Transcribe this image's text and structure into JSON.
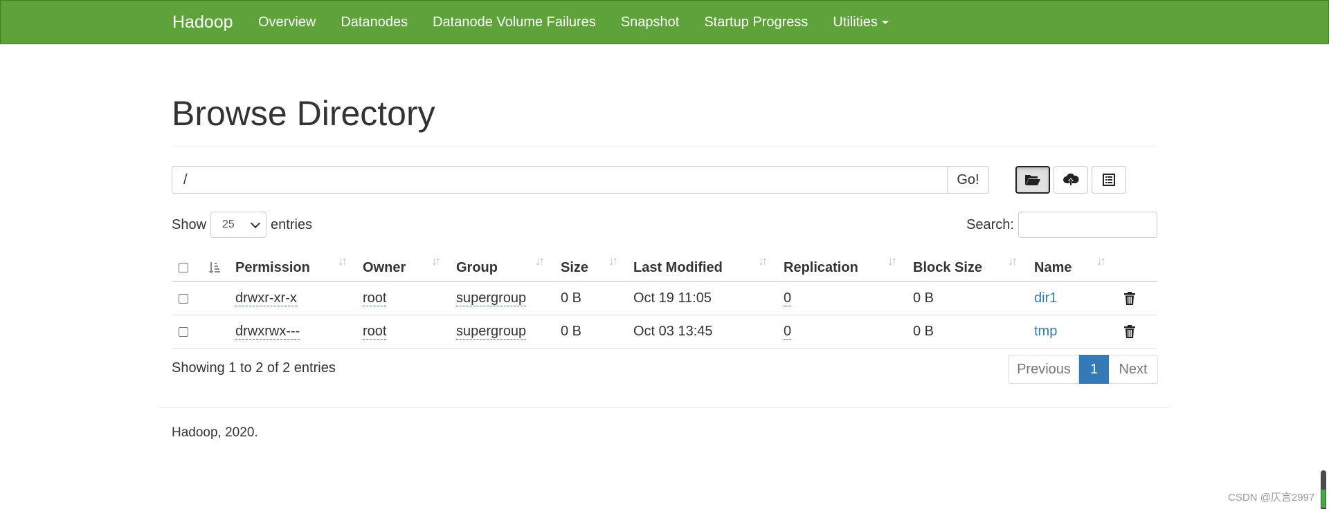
{
  "navbar": {
    "brand": "Hadoop",
    "items": [
      {
        "label": "Overview"
      },
      {
        "label": "Datanodes"
      },
      {
        "label": "Datanode Volume Failures"
      },
      {
        "label": "Snapshot"
      },
      {
        "label": "Startup Progress"
      },
      {
        "label": "Utilities"
      }
    ]
  },
  "page": {
    "title": "Browse Directory"
  },
  "path_bar": {
    "value": "/",
    "go_label": "Go!"
  },
  "toolbar": {
    "icons": [
      "folder-open-icon",
      "cloud-upload-icon",
      "list-icon"
    ]
  },
  "entries": {
    "show_label": "Show",
    "page_size": "25",
    "entries_label": "entries"
  },
  "search": {
    "label": "Search:",
    "value": ""
  },
  "table": {
    "columns": [
      "Permission",
      "Owner",
      "Group",
      "Size",
      "Last Modified",
      "Replication",
      "Block Size",
      "Name"
    ],
    "rows": [
      {
        "permission": "drwxr-xr-x",
        "owner": "root",
        "group": "supergroup",
        "size": "0 B",
        "last_modified": "Oct 19 11:05",
        "replication": "0",
        "block_size": "0 B",
        "name": "dir1"
      },
      {
        "permission": "drwxrwx---",
        "owner": "root",
        "group": "supergroup",
        "size": "0 B",
        "last_modified": "Oct 03 13:45",
        "replication": "0",
        "block_size": "0 B",
        "name": "tmp"
      }
    ]
  },
  "pagination": {
    "info": "Showing 1 to 2 of 2 entries",
    "previous": "Previous",
    "current": "1",
    "next": "Next"
  },
  "footer": {
    "text": "Hadoop, 2020."
  },
  "watermark": {
    "text": "CSDN @仄言2997"
  },
  "colors": {
    "navbar": "#5da33a",
    "link": "#337ab7",
    "active_page": "#337ab7"
  }
}
